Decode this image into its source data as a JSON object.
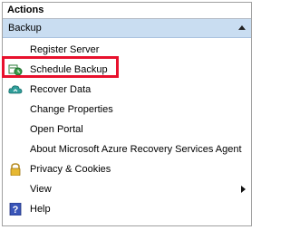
{
  "panel": {
    "title": "Actions",
    "section": {
      "label": "Backup",
      "state": "expanded"
    },
    "items": [
      {
        "label": "Register Server",
        "icon": "none"
      },
      {
        "label": "Schedule Backup",
        "icon": "schedule-backup-icon",
        "highlighted": true
      },
      {
        "label": "Recover Data",
        "icon": "cloud-recover-icon"
      },
      {
        "label": "Change Properties",
        "icon": "none"
      },
      {
        "label": "Open Portal",
        "icon": "none"
      },
      {
        "label": "About Microsoft Azure Recovery Services Agent",
        "icon": "none"
      },
      {
        "label": "Privacy & Cookies",
        "icon": "lock-icon"
      },
      {
        "label": "View",
        "icon": "none",
        "submenu": true
      },
      {
        "label": "Help",
        "icon": "help-icon"
      }
    ]
  },
  "colors": {
    "section_bar": "#c9ddf1",
    "highlight_border": "#e8112d"
  }
}
